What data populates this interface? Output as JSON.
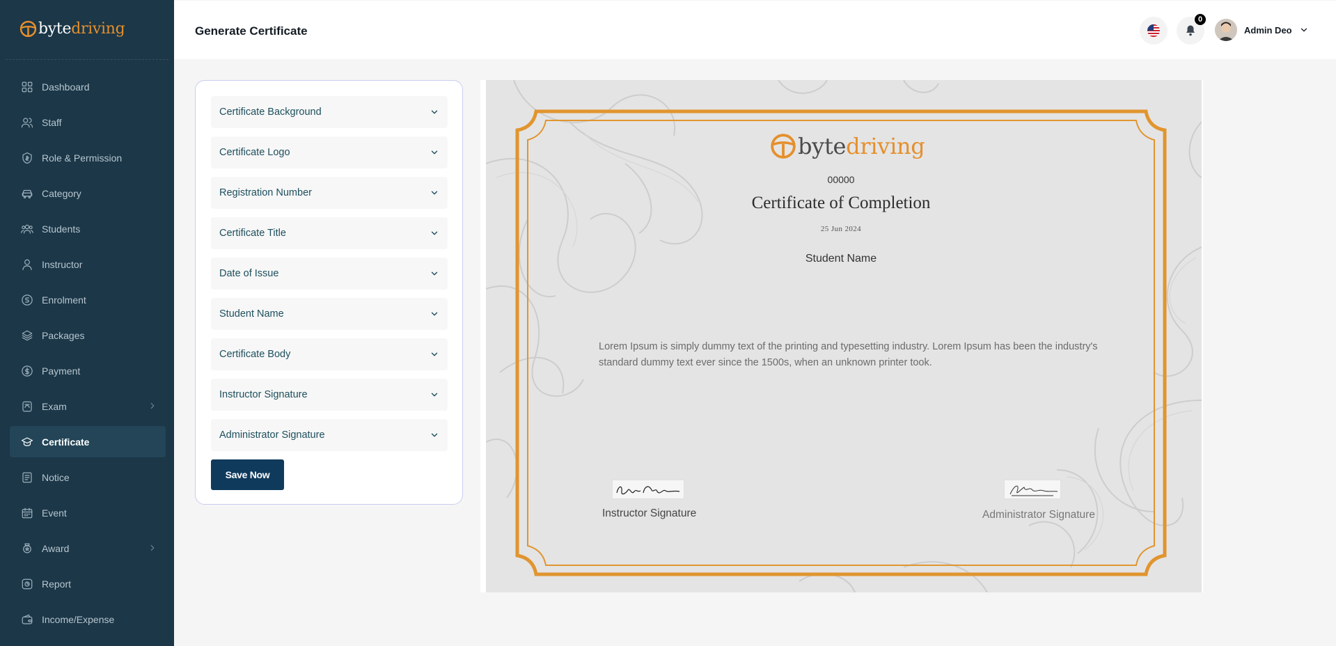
{
  "brand": {
    "part1": "byte",
    "part2": "driving"
  },
  "sidebar": {
    "items": [
      {
        "label": "Dashboard",
        "icon": "grid-icon",
        "active": false,
        "chevron": false
      },
      {
        "label": "Staff",
        "icon": "users-icon",
        "active": false,
        "chevron": false
      },
      {
        "label": "Role & Permission",
        "icon": "shield-icon",
        "active": false,
        "chevron": false
      },
      {
        "label": "Category",
        "icon": "car-icon",
        "active": false,
        "chevron": false
      },
      {
        "label": "Students",
        "icon": "group-icon",
        "active": false,
        "chevron": false
      },
      {
        "label": "Instructor",
        "icon": "user-icon",
        "active": false,
        "chevron": false
      },
      {
        "label": "Enrolment",
        "icon": "enrol-icon",
        "active": false,
        "chevron": false
      },
      {
        "label": "Packages",
        "icon": "layers-icon",
        "active": false,
        "chevron": false
      },
      {
        "label": "Payment",
        "icon": "dollar-icon",
        "active": false,
        "chevron": false
      },
      {
        "label": "Exam",
        "icon": "exam-icon",
        "active": false,
        "chevron": true
      },
      {
        "label": "Certificate",
        "icon": "graduation-cap-icon",
        "active": true,
        "chevron": false
      },
      {
        "label": "Notice",
        "icon": "notice-icon",
        "active": false,
        "chevron": false
      },
      {
        "label": "Event",
        "icon": "calendar-icon",
        "active": false,
        "chevron": false
      },
      {
        "label": "Award",
        "icon": "award-icon",
        "active": false,
        "chevron": true
      },
      {
        "label": "Report",
        "icon": "report-icon",
        "active": false,
        "chevron": false
      },
      {
        "label": "Income/Expense",
        "icon": "wallet-icon",
        "active": false,
        "chevron": false
      }
    ]
  },
  "header": {
    "title": "Generate Certificate",
    "flag_icon": "us-flag-icon",
    "notification_count": "0",
    "user_name": "Admin Deo"
  },
  "form": {
    "sections": [
      "Certificate Background",
      "Certificate Logo",
      "Registration Number",
      "Certificate Title",
      "Date of Issue",
      "Student Name",
      "Certificate Body",
      "Instructor Signature",
      "Administrator Signature"
    ],
    "save_label": "Save Now"
  },
  "certificate": {
    "registration_number": "00000",
    "title": "Certificate of Completion",
    "date": "25 Jun 2024",
    "student_name": "Student Name",
    "body": "Lorem Ipsum is simply dummy text of the printing and typesetting industry. Lorem Ipsum has been the industry's standard dummy text ever since the 1500s, when an unknown printer took.",
    "instructor_signature_label": "Instructor Signature",
    "administrator_signature_label": "Administrator Signature"
  },
  "colors": {
    "sidebar_bg": "#1b3748",
    "accent_orange": "#e58f2c",
    "button_navy": "#0f3a5c",
    "certificate_border": "#e1952f"
  }
}
